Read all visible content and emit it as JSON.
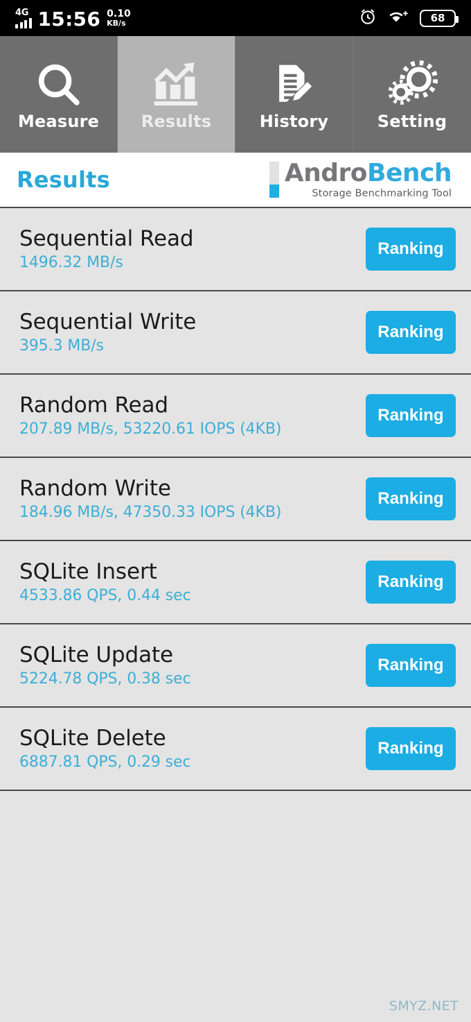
{
  "statusbar": {
    "network_type": "4G",
    "signal_icon": "signal-bars-icon",
    "time": "15:56",
    "data_speed_value": "0.10",
    "data_speed_unit": "KB/s",
    "alarm_icon": "alarm-clock-icon",
    "wifi_icon": "wifi-plus-icon",
    "battery_level": "68"
  },
  "tabs": [
    {
      "label": "Measure",
      "icon": "magnifier-icon",
      "active": false
    },
    {
      "label": "Results",
      "icon": "bar-chart-trend-icon",
      "active": true
    },
    {
      "label": "History",
      "icon": "document-pencil-icon",
      "active": false
    },
    {
      "label": "Setting",
      "icon": "gears-icon",
      "active": false
    }
  ],
  "header": {
    "title": "Results",
    "logo_name_part1": "Andro",
    "logo_name_part2": "Bench",
    "logo_tagline": "Storage Benchmarking Tool"
  },
  "results": [
    {
      "name": "Sequential Read",
      "value": "1496.32 MB/s",
      "button": "Ranking"
    },
    {
      "name": "Sequential Write",
      "value": "395.3 MB/s",
      "button": "Ranking"
    },
    {
      "name": "Random Read",
      "value": "207.89 MB/s, 53220.61 IOPS (4KB)",
      "button": "Ranking"
    },
    {
      "name": "Random Write",
      "value": "184.96 MB/s, 47350.33 IOPS (4KB)",
      "button": "Ranking"
    },
    {
      "name": "SQLite Insert",
      "value": "4533.86 QPS, 0.44 sec",
      "button": "Ranking"
    },
    {
      "name": "SQLite Update",
      "value": "5224.78 QPS, 0.38 sec",
      "button": "Ranking"
    },
    {
      "name": "SQLite Delete",
      "value": "6887.81 QPS, 0.29 sec",
      "button": "Ranking"
    }
  ],
  "watermark": "SMYZ.NET",
  "colors": {
    "accent_cyan": "#1BADE3",
    "value_text": "#3DAFD6",
    "title_text": "#29A8D8",
    "tab_inactive": "#6E6E6E",
    "tab_active": "#B4B4B4",
    "list_bg": "#E4E4E4",
    "watermark": "#8FB8C6"
  }
}
